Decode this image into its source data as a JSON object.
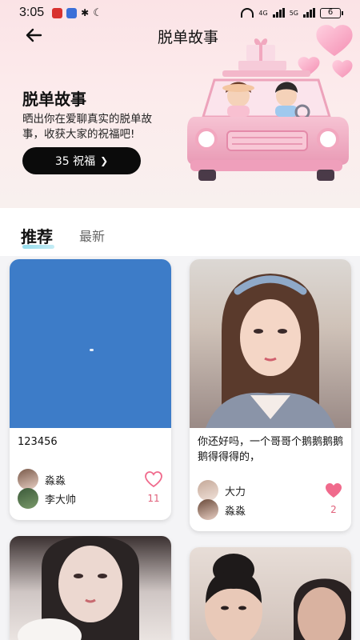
{
  "status": {
    "time": "3:05",
    "network": "4G",
    "network2": "5G",
    "battery": "6"
  },
  "nav": {
    "title": "脱单故事"
  },
  "hero": {
    "title": "脱单故事",
    "description": "晒出你在爱聊真实的脱单故事，收获大家的祝福吧!",
    "bless_button": "35 祝福"
  },
  "tabs": [
    {
      "label": "推荐",
      "active": true
    },
    {
      "label": "最新",
      "active": false
    }
  ],
  "cards": [
    {
      "image": "blue-sky-photo",
      "text": "123456",
      "users": [
        "淼淼",
        "李大帅"
      ],
      "likes": "11",
      "liked": false
    },
    {
      "image": "girl-portrait-photo",
      "text": "你还好吗，一个哥哥个鹅鹅鹅鹅鹅得得得的，",
      "users": [
        "大力",
        "淼淼"
      ],
      "likes": "2",
      "liked": true
    },
    {
      "image": "girl-selfie-photo",
      "text": "",
      "users": [],
      "likes": "",
      "liked": false
    },
    {
      "image": "couple-photo",
      "text": "",
      "users": [],
      "likes": "",
      "liked": false
    }
  ],
  "colors": {
    "accent_pink": "#f06a8c",
    "button_dark": "#0b0b0b",
    "hero_bg": "#fbe3e6"
  }
}
